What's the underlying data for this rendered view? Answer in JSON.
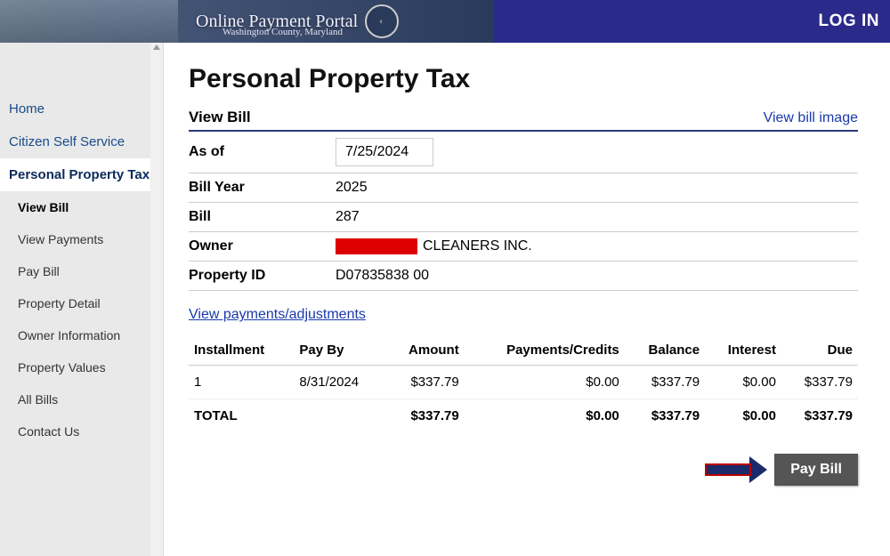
{
  "header": {
    "portal_title": "Online Payment Portal",
    "subtitle": "Washington County, Maryland",
    "login_label": "LOG IN"
  },
  "sidebar": {
    "items": [
      {
        "label": "Home"
      },
      {
        "label": "Citizen Self Service"
      },
      {
        "label": "Personal Property Tax"
      }
    ],
    "sub_items": [
      {
        "label": "View Bill"
      },
      {
        "label": "View Payments"
      },
      {
        "label": "Pay Bill"
      },
      {
        "label": "Property Detail"
      },
      {
        "label": "Owner Information"
      },
      {
        "label": "Property Values"
      },
      {
        "label": "All Bills"
      },
      {
        "label": "Contact Us"
      }
    ]
  },
  "page": {
    "title": "Personal Property Tax",
    "section_label": "View Bill",
    "view_image_link": "View bill image",
    "fields": {
      "as_of_label": "As of",
      "as_of_value": "7/25/2024",
      "bill_year_label": "Bill Year",
      "bill_year_value": "2025",
      "bill_label": "Bill",
      "bill_value": "287",
      "owner_label": "Owner",
      "owner_value": "CLEANERS INC.",
      "property_id_label": "Property ID",
      "property_id_value": "D07835838 00"
    },
    "view_payments_link": "View payments/adjustments",
    "table": {
      "headers": {
        "installment": "Installment",
        "pay_by": "Pay By",
        "amount": "Amount",
        "payments_credits": "Payments/Credits",
        "balance": "Balance",
        "interest": "Interest",
        "due": "Due"
      },
      "rows": [
        {
          "installment": "1",
          "pay_by": "8/31/2024",
          "amount": "$337.79",
          "payments_credits": "$0.00",
          "balance": "$337.79",
          "interest": "$0.00",
          "due": "$337.79"
        }
      ],
      "total": {
        "label": "TOTAL",
        "amount": "$337.79",
        "payments_credits": "$0.00",
        "balance": "$337.79",
        "interest": "$0.00",
        "due": "$337.79"
      }
    },
    "pay_button": "Pay Bill"
  }
}
